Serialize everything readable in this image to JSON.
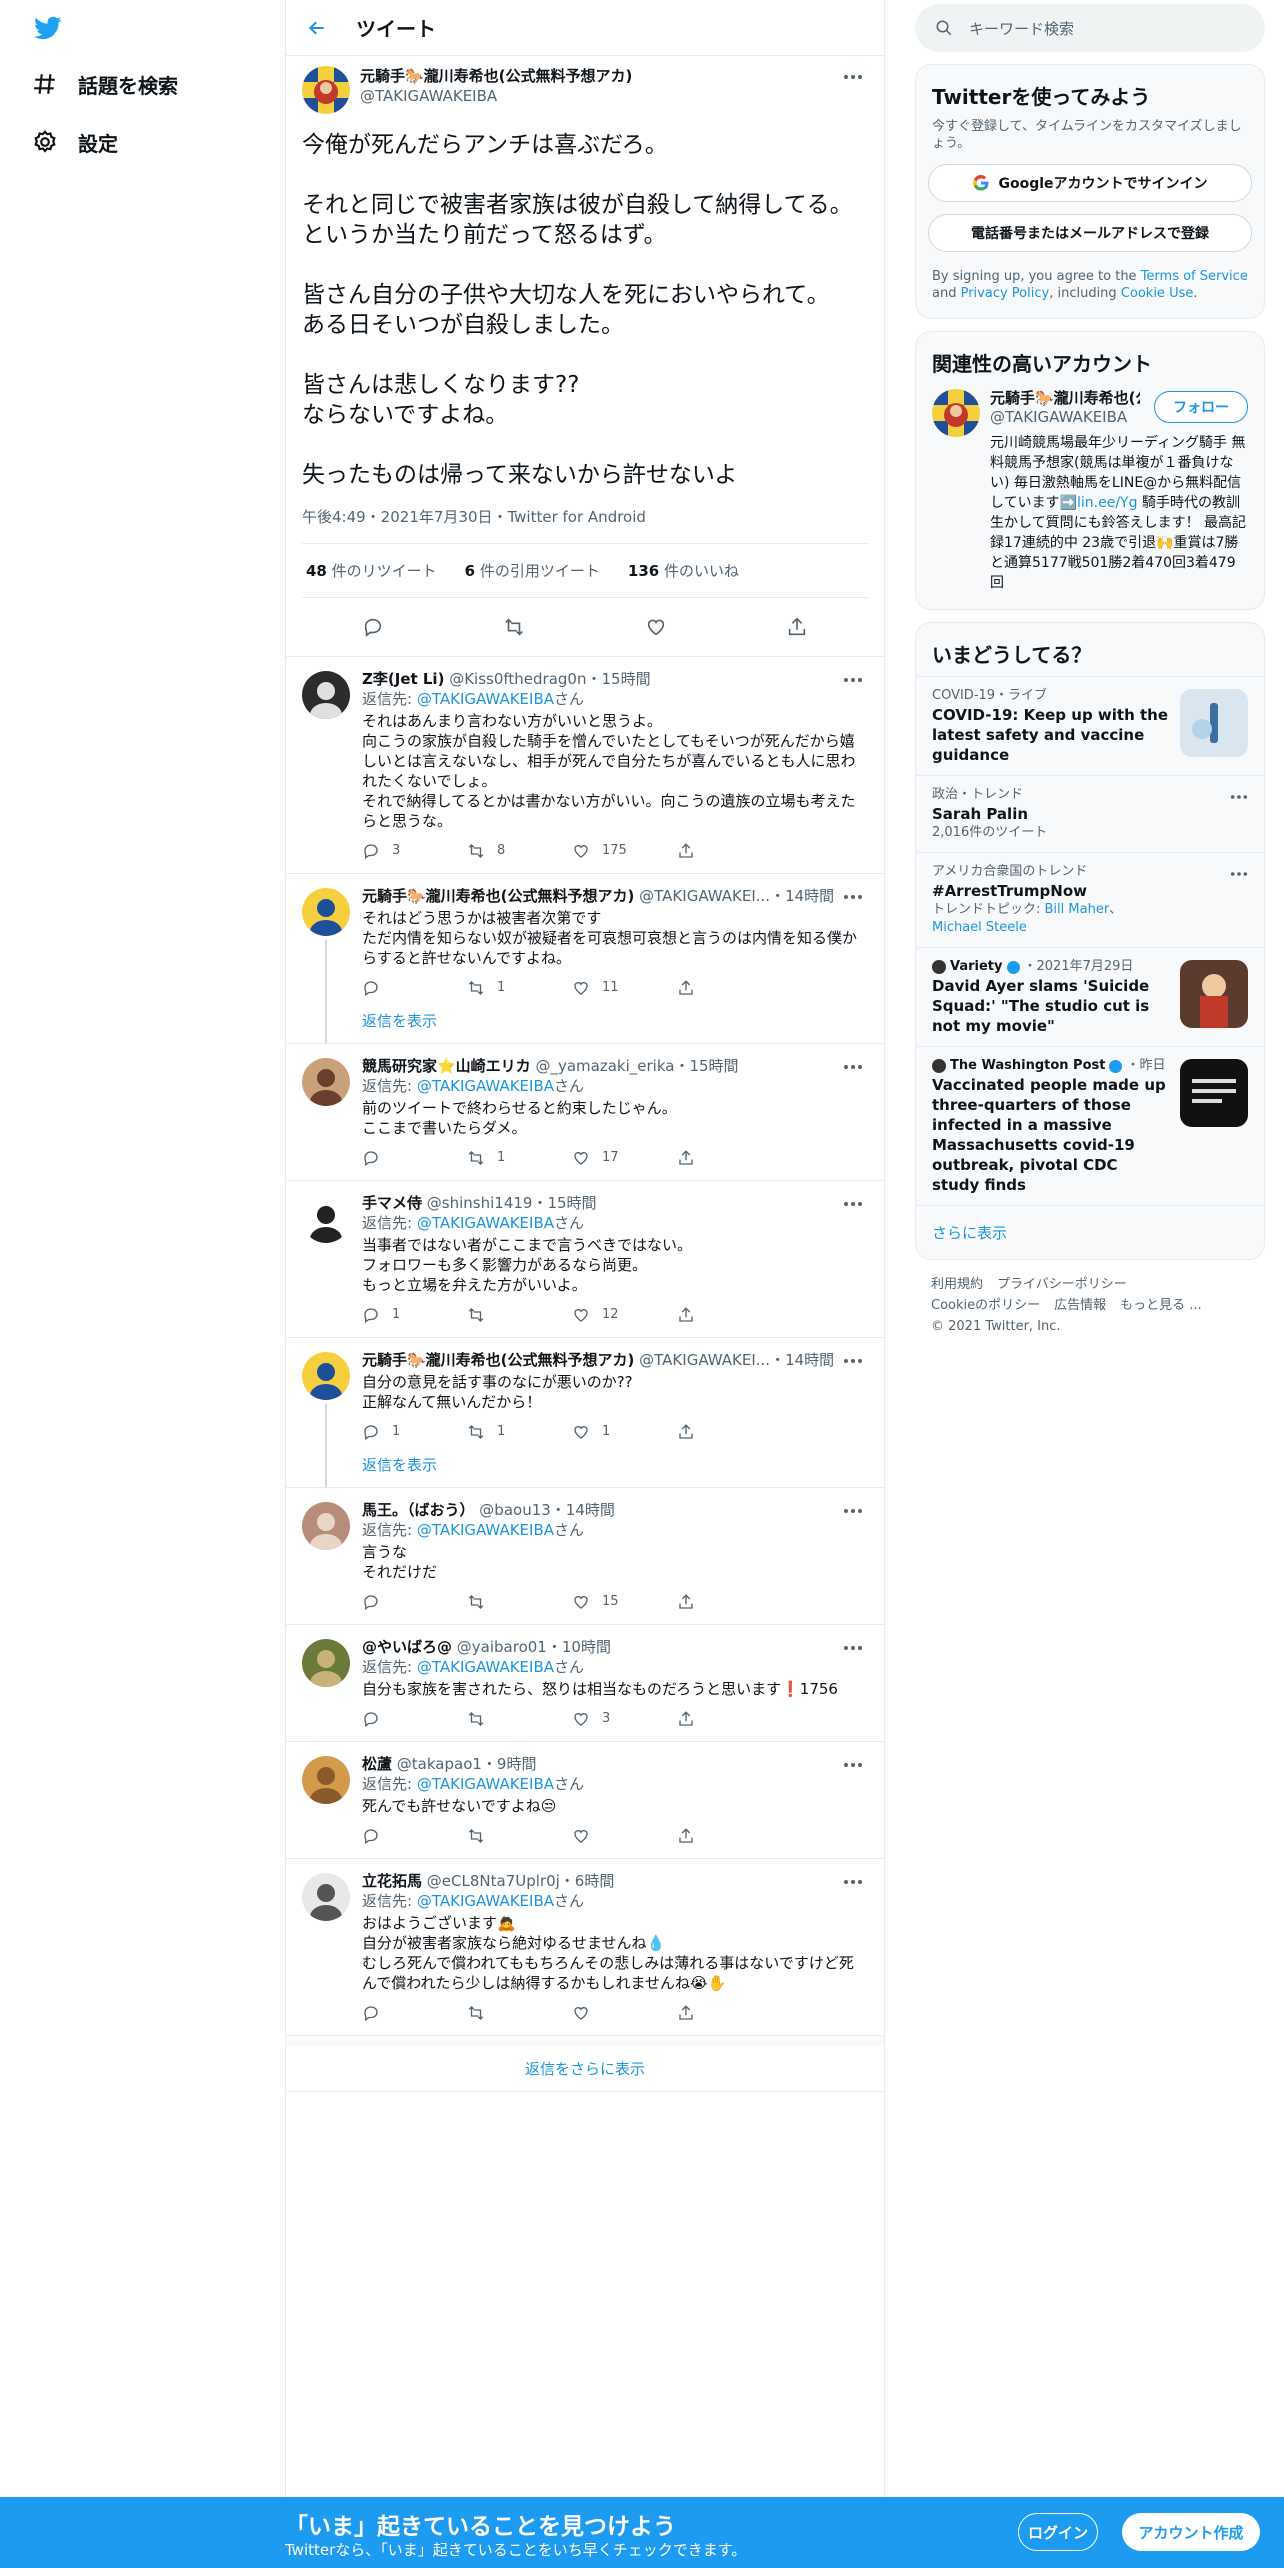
{
  "nav": {
    "explore": "話題を検索",
    "settings": "設定"
  },
  "header": {
    "title": "ツイート"
  },
  "focal": {
    "name": "元騎手🐎瀧川寿希也(公式無料予想アカ)",
    "handle": "@TAKIGAWAKEIBA",
    "text": "今俺が死んだらアンチは喜ぶだろ。\n\nそれと同じで被害者家族は彼が自殺して納得してる。\nというか当たり前だって怒るはず。\n\n皆さん自分の子供や大切な人を死においやられて。\nある日そいつが自殺しました。\n\n皆さんは悲しくなります??\nならないですよね。\n\n失ったものは帰って来ないから許せないよ",
    "meta": "午後4:49・2021年7月30日・Twitter for Android",
    "stats": {
      "retweets_count": "48",
      "retweets_label": "件のリツイート",
      "quotes_count": "6",
      "quotes_label": "件の引用ツイート",
      "likes_count": "136",
      "likes_label": "件のいいね"
    }
  },
  "replies": [
    {
      "name": "Z李(Jet Li)",
      "handle": "@Kiss0fthedrag0n",
      "time": "・15時間",
      "to_label": "返信先:",
      "to_handle": "@TAKIGAWAKEIBA",
      "to_suffix": "さん",
      "text": "それはあんまり言わない方がいいと思うよ。\n向こうの家族が自殺した騎手を憎んでいたとしてもそいつが死んだから嬉しいとは言えないなし、相手が死んで自分たちが喜んでいるとも人に思われたくないでしょ。\nそれで納得してるとかは書かない方がいい。向こうの遺族の立場も考えたらと思うな。",
      "reply": "3",
      "rt": "8",
      "like": "175"
    },
    {
      "name": "元騎手🐎瀧川寿希也(公式無料予想アカ)",
      "handle": "@TAKIGAWAKEI...",
      "time": "・14時間",
      "text": "それはどう思うかは被害者次第です\nただ内情を知らない奴が被疑者を可哀想可哀想と言うのは内情を知る僕からすると許せないんですよね。",
      "reply": "",
      "rt": "1",
      "like": "11",
      "show": "返信を表示"
    },
    {
      "name": "競馬研究家⭐山崎エリカ",
      "handle": "@_yamazaki_erika",
      "time": "・15時間",
      "to_label": "返信先:",
      "to_handle": "@TAKIGAWAKEIBA",
      "to_suffix": "さん",
      "text": "前のツイートで終わらせると約束したじゃん。\nここまで書いたらダメ。",
      "reply": "",
      "rt": "1",
      "like": "17"
    },
    {
      "name": "手マメ侍",
      "handle": "@shinshi1419",
      "time": "・15時間",
      "to_label": "返信先:",
      "to_handle": "@TAKIGAWAKEIBA",
      "to_suffix": "さん",
      "text": "当事者ではない者がここまで言うべきではない。\nフォロワーも多く影響力があるなら尚更。\nもっと立場を弁えた方がいいよ。",
      "reply": "1",
      "rt": "",
      "like": "12"
    },
    {
      "name": "元騎手🐎瀧川寿希也(公式無料予想アカ)",
      "handle": "@TAKIGAWAKEI...",
      "time": "・14時間",
      "text": "自分の意見を話す事のなにが悪いのか??\n正解なんて無いんだから！",
      "reply": "1",
      "rt": "1",
      "like": "1",
      "show": "返信を表示"
    },
    {
      "name": "馬王。（ばおう）",
      "handle": "@baou13",
      "time": "・14時間",
      "to_label": "返信先:",
      "to_handle": "@TAKIGAWAKEIBA",
      "to_suffix": "さん",
      "text": "言うな\nそれだけだ",
      "reply": "",
      "rt": "",
      "like": "15"
    },
    {
      "name": "@やいばろ@",
      "handle": "@yaibaro01",
      "time": "・10時間",
      "to_label": "返信先:",
      "to_handle": "@TAKIGAWAKEIBA",
      "to_suffix": "さん",
      "text": "自分も家族を害されたら、怒りは相当なものだろうと思います❗1756",
      "reply": "",
      "rt": "",
      "like": "3"
    },
    {
      "name": "松蘆",
      "handle": "@takapao1",
      "time": "・9時間",
      "to_label": "返信先:",
      "to_handle": "@TAKIGAWAKEIBA",
      "to_suffix": "さん",
      "text": "死んでも許せないですよね😒",
      "reply": "",
      "rt": "",
      "like": ""
    },
    {
      "name": "立花拓馬",
      "handle": "@eCL8Nta7Uplr0j",
      "time": "・6時間",
      "to_label": "返信先:",
      "to_handle": "@TAKIGAWAKEIBA",
      "to_suffix": "さん",
      "text": "おはようございます🙇\n自分が被害者家族なら絶対ゆるせませんね💧\nむしろ死んで償われてももちろんその悲しみは薄れる事はないですけど死んで償われたら少しは納得するかもしれませんね😭✋",
      "reply": "",
      "rt": "",
      "like": ""
    }
  ],
  "show_more": "返信をさらに表示",
  "search": {
    "placeholder": "キーワード検索"
  },
  "signup": {
    "title": "Twitterを使ってみよう",
    "sub": "今すぐ登録して、タイムラインをカスタマイズしましょう。",
    "google": "Googleアカウントでサインイン",
    "phone": "電話番号またはメールアドレスで登録",
    "terms_pre": "By signing up, you agree to the ",
    "terms_tos": "Terms of Service",
    "terms_and": " and ",
    "terms_pp": "Privacy Policy",
    "terms_inc": ", including ",
    "terms_cookie": "Cookie Use",
    "terms_end": "."
  },
  "related": {
    "title": "関連性の高いアカウント",
    "name": "元騎手🐎瀧川寿希也(公式無料予想アカ)",
    "handle": "@TAKIGAWAKEIBA",
    "follow": "フォロー",
    "bio": "元川崎競馬場最年少リーディング騎手 無料競馬予想家(競馬は単複が１番負けない) 毎日激熱軸馬をLINE@から無料配信しています➡️",
    "bio_link": "lin.ee/Yg",
    "bio_rest": " 騎手時代の教訓生かして質問にも鈴答えします！ 最高記録17連続的中 23歳で引退🙌重賞は7勝と通算5177戦501勝2着470回3着479回"
  },
  "trends": {
    "title": "いまどうしてる？",
    "items": [
      {
        "meta": "COVID-19・ライブ",
        "title": "COVID-19: Keep up with the latest safety and vaccine guidance",
        "thumb": "vaccine"
      },
      {
        "meta": "政治・トレンド",
        "title": "Sarah Palin",
        "sub": "2,016件のツイート",
        "dots": true
      },
      {
        "meta": "アメリカ合衆国のトレンド",
        "title": "#ArrestTrumpNow",
        "sub_pre": "トレンドトピック: ",
        "sub_l1": "Bill Maher",
        "sub_sep": "、",
        "sub_l2": "Michael Steele",
        "dots": true
      },
      {
        "meta_src": "Variety",
        "meta_date": "・2021年7月29日",
        "title": "David Ayer slams 'Suicide Squad:' \"The studio cut is not my movie\"",
        "thumb": "variety"
      },
      {
        "meta_src": "The Washington Post",
        "meta_date": "・昨日",
        "title": "Vaccinated people made up three-quarters of those infected in a massive Massachusetts covid-19 outbreak, pivotal CDC study finds",
        "thumb": "wapo"
      }
    ],
    "more": "さらに表示"
  },
  "footer": {
    "l1": "利用規約",
    "l2": "プライバシーポリシー",
    "l3": "Cookieのポリシー",
    "l4": "広告情報",
    "l5": "もっと見る ...",
    "copy": "© 2021 Twitter, Inc."
  },
  "bottombar": {
    "heading": "「いま」起きていることを見つけよう",
    "sub": "Twitterなら、「いま」起きていることをいち早くチェックできます。",
    "login": "ログイン",
    "signup": "アカウント作成"
  },
  "colors": {
    "accent": "#1b95e0",
    "banner": "#1d9bf0"
  }
}
